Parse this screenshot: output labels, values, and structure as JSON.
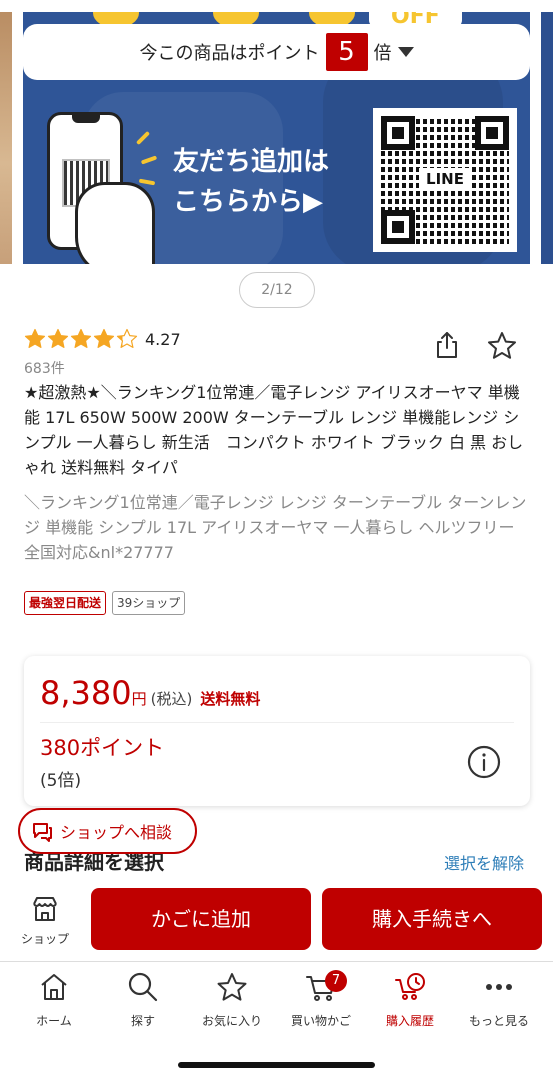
{
  "banner": {
    "point_prefix": "今この商品はポイント",
    "point_value": "5",
    "point_suffix": "倍",
    "friend_line1": "友だち追加は",
    "friend_line2": "こちらから▶",
    "qr_label": "LINE",
    "off_label": "OFF",
    "page_indicator": "2/12"
  },
  "product": {
    "rating": "4.27",
    "rating_stars_fraction": 0.854,
    "review_count": "683件",
    "title": "★超激熱★＼ランキング1位常連／電子レンジ アイリスオーヤマ 単機能 17L 650W 500W 200W ターンテーブル レンジ 単機能レンジ シンプル 一人暮らし 新生活　コンパクト ホワイト ブラック 白 黒 おしゃれ 送料無料 タイパ",
    "catch_copy": "＼ランキング1位常連／電子レンジ レンジ ターンテーブル ターンレンジ 単機能 シンプル 17L アイリスオーヤマ 一人暮らし ヘルツフリー 全国対応&nl*27777",
    "badges": [
      "最強翌日配送",
      "39ショップ"
    ]
  },
  "price": {
    "amount": "8,380",
    "yen": "円",
    "tax": "(税込)",
    "shipping": "送料無料",
    "points": "380ポイント",
    "multiplier": "(5倍)"
  },
  "consult": {
    "label": "ショップへ相談"
  },
  "section": {
    "title": "商品詳細を選択",
    "clear_label": "選択を解除"
  },
  "buybar": {
    "shop_label": "ショップ",
    "cart_label": "かごに追加",
    "checkout_label": "購入手続きへ"
  },
  "tabs": [
    {
      "label": "ホーム",
      "icon": "home-icon"
    },
    {
      "label": "探す",
      "icon": "search-icon"
    },
    {
      "label": "お気に入り",
      "icon": "star-icon"
    },
    {
      "label": "買い物かご",
      "icon": "cart-icon",
      "badge": "7"
    },
    {
      "label": "購入履歴",
      "icon": "purchase-history-icon",
      "active": true
    },
    {
      "label": "もっと見る",
      "icon": "more-icon"
    }
  ],
  "colors": {
    "accent": "#bf0000",
    "link": "#2e7eb8",
    "star": "#f5a623",
    "banner": "#2f5597"
  }
}
